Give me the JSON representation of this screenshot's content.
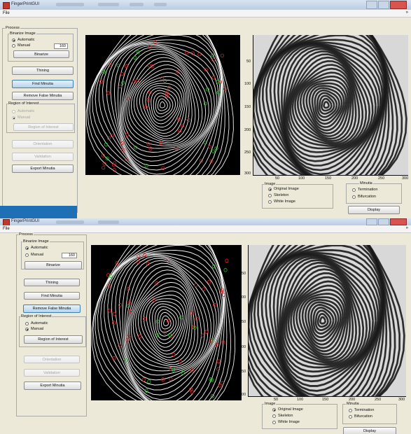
{
  "window": {
    "title": "FingerPrintGUI"
  },
  "menu": {
    "file": "File",
    "arrow": "»"
  },
  "left_panel": {
    "process_label": "Process",
    "binarize": {
      "group_label": "Binarize Image",
      "automatic": "Automatic",
      "manual": "Manual",
      "threshold": "160",
      "button": "Binarize"
    },
    "thining_button": "Thining",
    "find_minutia_button": "Find Minutia",
    "remove_false_minutia_button": "Remove False Minutia",
    "roi": {
      "group_label": "Region of Interest",
      "automatic": "Automatic",
      "manual": "Manual",
      "button": "Region of Interest"
    },
    "orientation_button": "Orientation",
    "validation_button": "Validation",
    "export_button": "Export Minutia"
  },
  "image_axes": {
    "x_ticks": [
      "50",
      "100",
      "150",
      "200",
      "250",
      "300"
    ],
    "y_ticks": [
      "50",
      "100",
      "150",
      "200",
      "250",
      "300"
    ]
  },
  "bottom_controls": {
    "image_group": {
      "label": "Image",
      "original": "Original Image",
      "skeleton": "Skeleton",
      "white": "White Image"
    },
    "minutia_group": {
      "label": "Minutia",
      "termination": "Termination",
      "bifurcation": "Bifurcation"
    },
    "display_button": "Display"
  },
  "colors": {
    "accent_active": "#b5d3ef",
    "termination_marker": "#e02020",
    "bifurcation_marker": "#20c020",
    "ridge": "#ffffff"
  }
}
